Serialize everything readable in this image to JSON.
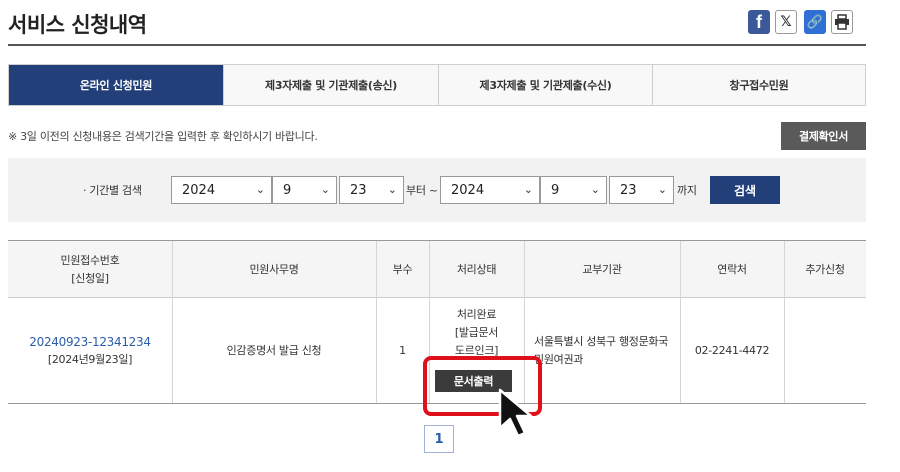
{
  "header": {
    "title": "서비스 신청내역",
    "share_icons": [
      "facebook-icon",
      "x-icon",
      "link-icon",
      "print-icon"
    ]
  },
  "tabs": [
    {
      "label": "온라인 신청민원",
      "active": true
    },
    {
      "label": "제3자제출 및 기관제출(송신)",
      "active": false
    },
    {
      "label": "제3자제출 및 기관제출(수신)",
      "active": false
    },
    {
      "label": "창구접수민원",
      "active": false
    }
  ],
  "notice": "※ 3일 이전의 신청내용은 검색기간을 입력한 후 확인하시기 바랍니다.",
  "confirm_button": "결제확인서",
  "search": {
    "label": "· 기간별 검색",
    "from_year": "2024",
    "from_month": "9",
    "from_day": "23",
    "from_text": "부터 ~",
    "to_year": "2024",
    "to_month": "9",
    "to_day": "23",
    "to_text": "까지",
    "button": "검색"
  },
  "table": {
    "headers": {
      "receipt_no": "민원접수번호",
      "receipt_no_sub": "[신청일]",
      "service_name": "민원사무명",
      "copies": "부수",
      "status": "처리상태",
      "agency": "교부기관",
      "contact": "연락처",
      "extra": "추가신청"
    },
    "rows": [
      {
        "receipt_no": "20240923-12341234",
        "date": "[2024년9월23일]",
        "service_name": "인감증명서 발급 신청",
        "copies": "1",
        "status_line1": "처리완료",
        "status_line2": "[발급문서",
        "status_line3": "도르인크]",
        "print_button": "문서출력",
        "agency_line1": "서울특별시 성북구 행정문화국",
        "agency_line2": "민원여권과",
        "contact": "02-2241-4472",
        "extra": ""
      }
    ]
  },
  "pagination": {
    "current": "1"
  },
  "colors": {
    "primary": "#223f7a",
    "highlight": "#e0101a",
    "dark_button": "#3b3b3b"
  }
}
